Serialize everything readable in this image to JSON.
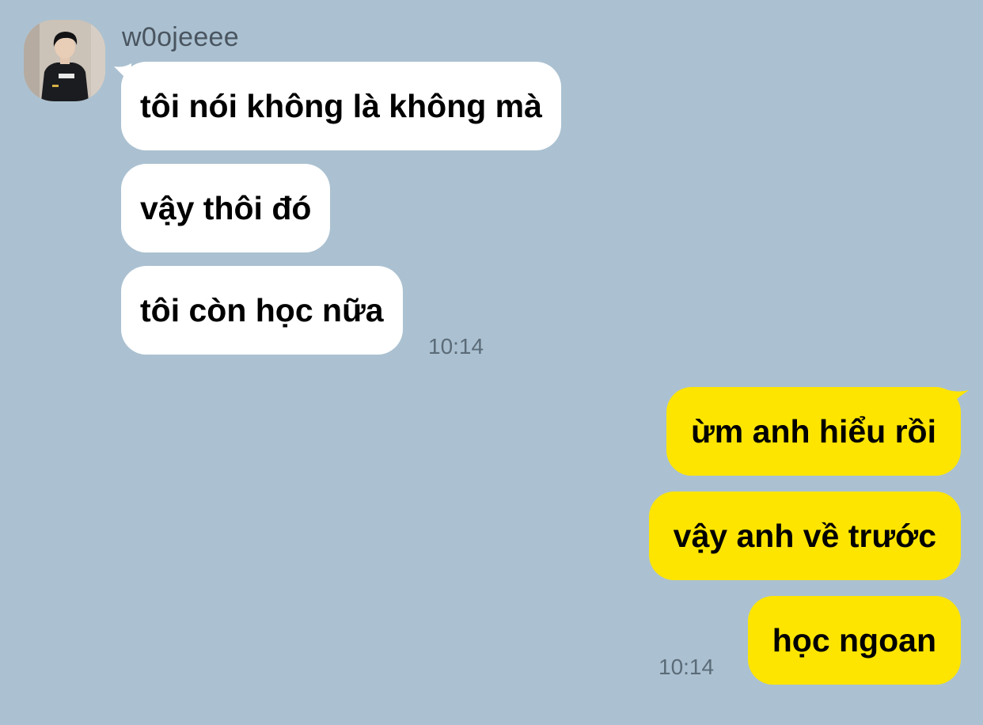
{
  "chat": {
    "sender": {
      "name": "w0ojeeee",
      "avatar_icon": "profile-avatar"
    },
    "incoming": {
      "messages": [
        "tôi nói không là không mà",
        "vậy thôi đó",
        "tôi còn học nữa"
      ],
      "time": "10:14"
    },
    "outgoing": {
      "messages": [
        "ừm anh hiểu rồi",
        "vậy anh về trước",
        "học ngoan"
      ],
      "time": "10:14"
    }
  },
  "colors": {
    "background": "#abc1d1",
    "incoming_bubble": "#ffffff",
    "outgoing_bubble": "#fee500",
    "timestamp": "#5b6b78",
    "sender_name": "#4a5560"
  }
}
